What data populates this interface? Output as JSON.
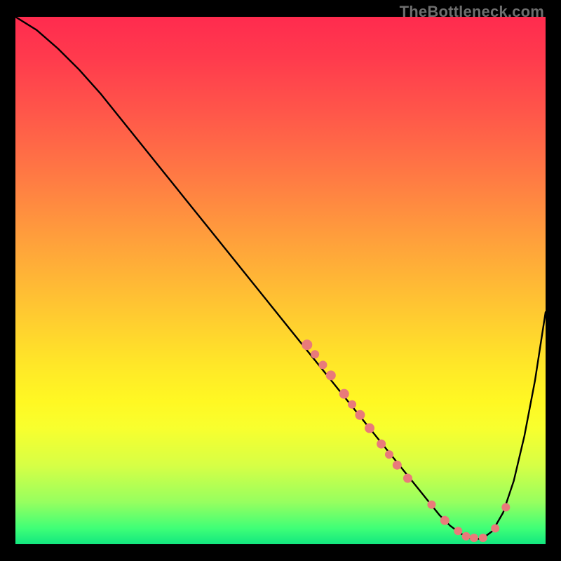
{
  "watermark": "TheBottleneck.com",
  "chart_data": {
    "type": "line",
    "title": "",
    "xlabel": "",
    "ylabel": "",
    "xlim": [
      0,
      100
    ],
    "ylim": [
      0,
      100
    ],
    "grid": false,
    "legend": false,
    "series": [
      {
        "name": "bottleneck-curve",
        "x": [
          0,
          4,
          8,
          12,
          16,
          20,
          24,
          28,
          32,
          36,
          40,
          44,
          48,
          52,
          56,
          60,
          64,
          68,
          72,
          76,
          80,
          82,
          84,
          86,
          88,
          90,
          92,
          94,
          96,
          98,
          100
        ],
        "y": [
          100,
          97.5,
          94.0,
          90.0,
          85.5,
          80.5,
          75.5,
          70.5,
          65.5,
          60.5,
          55.5,
          50.5,
          45.5,
          40.5,
          35.5,
          30.5,
          25.5,
          20.5,
          15.5,
          10.5,
          5.5,
          3.5,
          2.0,
          1.0,
          1.0,
          2.5,
          6.0,
          12.0,
          20.5,
          31.0,
          44.0
        ]
      }
    ],
    "markers": {
      "name": "marker-dots",
      "x": [
        55,
        56.5,
        58,
        59.5,
        62,
        63.5,
        65,
        66.8,
        69,
        70.5,
        72,
        74,
        78.5,
        81,
        83.5,
        85,
        86.5,
        88.2,
        90.5,
        92.5
      ],
      "y": [
        37.8,
        36.0,
        34.0,
        32.0,
        28.5,
        26.5,
        24.5,
        22.0,
        19.0,
        17.0,
        15.0,
        12.5,
        7.5,
        4.5,
        2.5,
        1.5,
        1.2,
        1.2,
        3.0,
        7.0
      ],
      "r": [
        7.5,
        6.0,
        6.0,
        7.0,
        7.0,
        6.0,
        7.0,
        7.0,
        6.5,
        6.0,
        6.5,
        6.5,
        6.0,
        6.5,
        6.0,
        6.0,
        6.0,
        6.0,
        6.0,
        6.0
      ]
    },
    "marker_color": "#e97a7a",
    "line_color": "#000000",
    "line_width": 2.4
  }
}
